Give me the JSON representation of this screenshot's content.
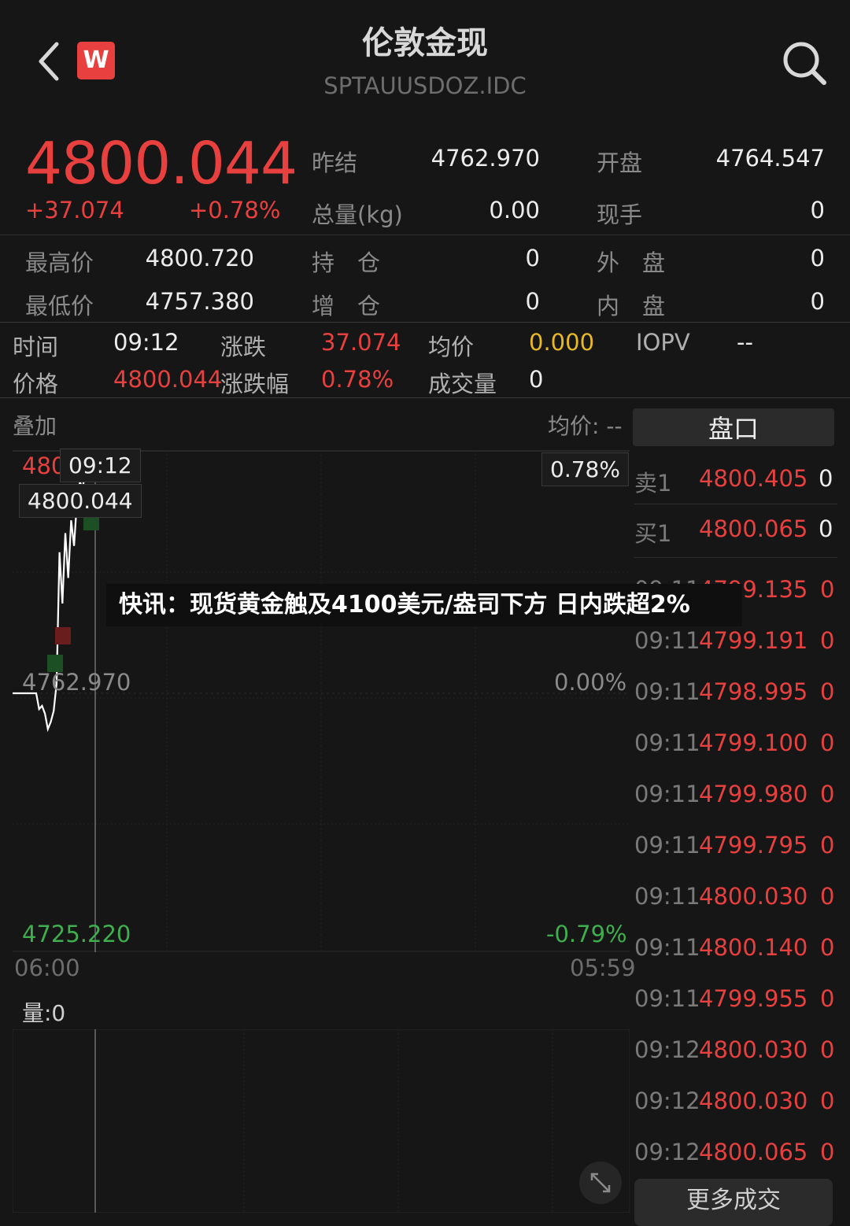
{
  "header": {
    "title": "伦敦金现",
    "code": "SPTAUUSDOZ.IDC",
    "logo_letter": "W"
  },
  "quote": {
    "price": "4800.044",
    "change": "+37.074",
    "change_pct": "+0.78%",
    "fields": {
      "prev_close_label": "昨结",
      "prev_close": "4762.970",
      "open_label": "开盘",
      "open": "4764.547",
      "volume_label": "总量(kg)",
      "volume": "0.00",
      "cur_hand_label": "现手",
      "cur_hand": "0",
      "high_label": "最高价",
      "high": "4800.720",
      "hold_label": "持　仓",
      "hold": "0",
      "outer_label": "外　盘",
      "outer": "0",
      "low_label": "最低价",
      "low": "4757.380",
      "add_label": "增　仓",
      "add": "0",
      "inner_label": "内　盘",
      "inner": "0"
    }
  },
  "detail": {
    "time_label": "时间",
    "time": "09:12",
    "chg_label": "涨跌",
    "chg": "37.074",
    "avg_label": "均价",
    "avg": "0.000",
    "iopv_label": "IOPV",
    "iopv": "--",
    "price_label": "价格",
    "price": "4800.044",
    "chg_pct_label": "涨跌幅",
    "chg_pct": "0.78%",
    "vol_label": "成交量",
    "vol": "0"
  },
  "chart": {
    "overlay_label": "叠加",
    "avg_label": "均价: --",
    "top_price": "480",
    "mid_price": "4762.970",
    "bottom_price": "4725.220",
    "top_pct": "0.78%",
    "mid_pct": "0.00%",
    "bottom_pct": "-0.79%",
    "start_time": "06:00",
    "end_time": "05:59",
    "cursor_time": "09:12",
    "cursor_price": "4800.044",
    "volume_label": "量:0",
    "colors": {
      "up": "#e8403f",
      "down": "#3fae4f",
      "line": "#ffffff"
    }
  },
  "chart_data": {
    "type": "line",
    "x_range": [
      "06:00",
      "05:59"
    ],
    "ylim": [
      4725.22,
      4800.72
    ],
    "reference": 4762.97,
    "series": [
      {
        "values": [
          4762.97,
          4762.97,
          4760.5,
          4761.0,
          4759.8,
          4757.38,
          4758.5,
          4760.2,
          4764.5,
          4785.0,
          4777.0,
          4788.0,
          4781.0,
          4790.0,
          4786.0,
          4793.0,
          4796.0,
          4795.0,
          4798.5,
          4797.8,
          4800.72,
          4800.044
        ]
      }
    ]
  },
  "pankou": {
    "button_label": "盘口",
    "sell1_label": "卖1",
    "sell1_price": "4800.405",
    "sell1_vol": "0",
    "buy1_label": "买1",
    "buy1_price": "4800.065",
    "buy1_vol": "0",
    "trades": [
      {
        "time": "09:11",
        "price": "4799.135",
        "vol": "0"
      },
      {
        "time": "09:11",
        "price": "4799.191",
        "vol": "0"
      },
      {
        "time": "09:11",
        "price": "4798.995",
        "vol": "0"
      },
      {
        "time": "09:11",
        "price": "4799.100",
        "vol": "0"
      },
      {
        "time": "09:11",
        "price": "4799.980",
        "vol": "0"
      },
      {
        "time": "09:11",
        "price": "4799.795",
        "vol": "0"
      },
      {
        "time": "09:11",
        "price": "4800.030",
        "vol": "0"
      },
      {
        "time": "09:11",
        "price": "4800.140",
        "vol": "0"
      },
      {
        "time": "09:11",
        "price": "4799.955",
        "vol": "0"
      },
      {
        "time": "09:12",
        "price": "4800.030",
        "vol": "0"
      },
      {
        "time": "09:12",
        "price": "4800.030",
        "vol": "0"
      },
      {
        "time": "09:12",
        "price": "4800.065",
        "vol": "0"
      }
    ],
    "more_label": "更多成交"
  },
  "headline": "快讯：现货黄金触及4100美元/盎司下方 日内跌超2%",
  "icons": [
    "back-arrow-icon",
    "search-icon",
    "expand-icon"
  ]
}
